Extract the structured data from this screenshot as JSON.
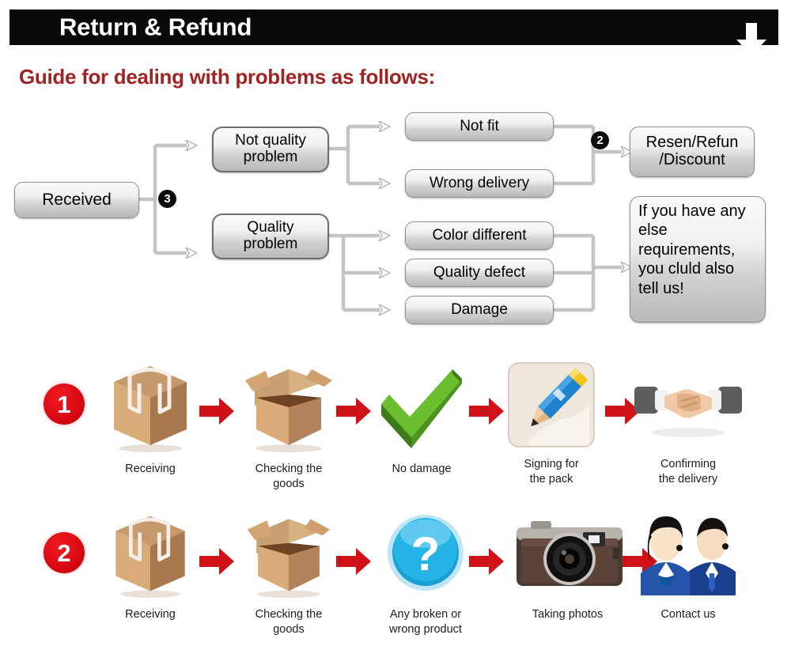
{
  "header": {
    "title": "Return & Refund",
    "down_arrow_icon": "down-arrow-icon",
    "bar_color": "#0a0a0a",
    "title_color": "#ffffff"
  },
  "guide": {
    "heading": "Guide for dealing with problems as follows:",
    "heading_color": "#A02423"
  },
  "flowchart": {
    "boxes": {
      "received": "Received",
      "not_quality_problem": "Not quality\nproblem",
      "quality_problem": "Quality\nproblem",
      "not_fit": "Not fit",
      "wrong_delivery": "Wrong delivery",
      "color_different": "Color different",
      "quality_defect": "Quality defect",
      "damage": "Damage",
      "resend_refund": "Resen/Refun\n/Discount",
      "note": "If you have any else requirements, you cluld also tell us!"
    },
    "badges": {
      "branch_three": "3",
      "branch_two": "2"
    },
    "connector_color": "#bdbdbd"
  },
  "process": {
    "rows": [
      {
        "badge": "1",
        "steps": [
          {
            "caption": "Receiving",
            "icon": "closed-box-icon"
          },
          {
            "caption": "Checking the\ngoods",
            "icon": "open-box-icon"
          },
          {
            "caption": "No damage",
            "icon": "green-checkmark-icon"
          },
          {
            "caption": "Signing for\nthe pack",
            "icon": "pencil-signing-icon"
          },
          {
            "caption": "Confirming\nthe delivery",
            "icon": "handshake-icon"
          }
        ]
      },
      {
        "badge": "2",
        "steps": [
          {
            "caption": "Receiving",
            "icon": "closed-box-icon"
          },
          {
            "caption": "Checking the\ngoods",
            "icon": "open-box-icon"
          },
          {
            "caption": "Any broken or\nwrong product",
            "icon": "question-mark-icon"
          },
          {
            "caption": "Taking photos",
            "icon": "camera-icon"
          },
          {
            "caption": "Contact us",
            "icon": "support-agents-icon"
          }
        ]
      }
    ],
    "arrow_icon": "red-right-arrow-icon",
    "arrow_color": "#cf1118",
    "badge_color": "#d80812"
  }
}
